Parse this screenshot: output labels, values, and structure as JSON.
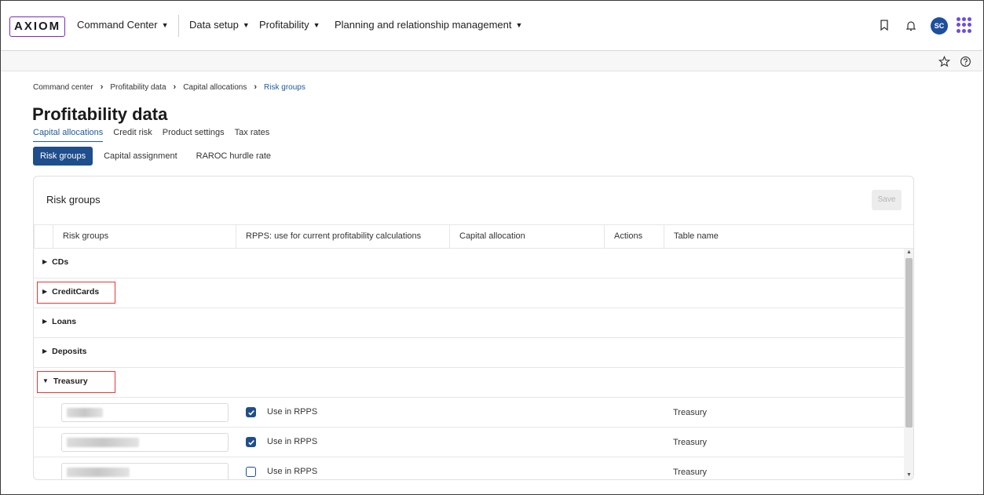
{
  "header": {
    "logo": "AXIOM",
    "nav": [
      {
        "label": "Command Center",
        "caret": "▼"
      },
      {
        "label": "Data setup",
        "caret": "▼"
      },
      {
        "label": "Profitability",
        "caret": "▼"
      },
      {
        "label": "Planning and relationship management",
        "caret": "▼"
      }
    ],
    "avatar_initials": "SC",
    "icons": [
      "bookmark-icon",
      "bell-icon",
      "apps-grid-icon"
    ]
  },
  "subbar": {
    "icons": [
      "star-icon",
      "help-icon"
    ]
  },
  "breadcrumb": [
    "Command center",
    "Profitability data",
    "Capital allocations",
    "Risk groups"
  ],
  "breadcrumb_sep": "›",
  "page_title": "Profitability data",
  "tabs": [
    "Capital allocations",
    "Credit risk",
    "Product settings",
    "Tax rates"
  ],
  "subtabs": [
    "Risk groups",
    "Capital assignment",
    "RAROC hurdle rate"
  ],
  "panel": {
    "title": "Risk groups",
    "save_label": "Save",
    "columns": [
      "Risk groups",
      "RPPS: use for current profitability calculations",
      "Capital allocation",
      "Actions",
      "Table name"
    ],
    "groups": [
      {
        "name": "CDs",
        "arrow": "▶",
        "highlighted": false
      },
      {
        "name": "CreditCards",
        "arrow": "▶",
        "highlighted": true
      },
      {
        "name": "Loans",
        "arrow": "▶",
        "highlighted": false
      },
      {
        "name": "Deposits",
        "arrow": "▶",
        "highlighted": false
      },
      {
        "name": "Treasury",
        "arrow": "▼",
        "highlighted": true
      }
    ],
    "treasury_rows": [
      {
        "rpps_label": "Use in RPPS",
        "checked": true,
        "table_name": "Treasury"
      },
      {
        "rpps_label": "Use in RPPS",
        "checked": true,
        "table_name": "Treasury"
      },
      {
        "rpps_label": "Use in RPPS",
        "checked": false,
        "table_name": "Treasury"
      }
    ]
  },
  "colors": {
    "accent": "#1f4e8c",
    "highlight": "#e53935",
    "logo_border": "#7b2cbf"
  }
}
